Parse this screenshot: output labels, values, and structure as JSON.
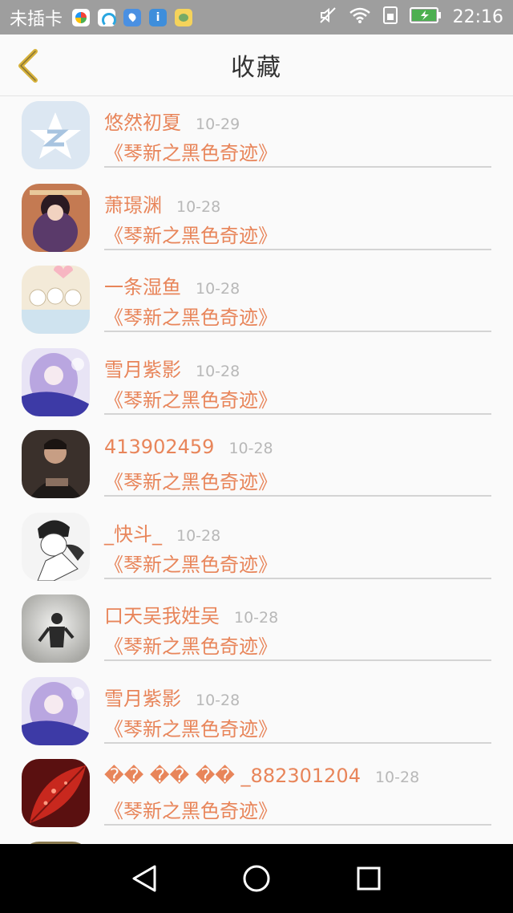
{
  "status_bar": {
    "carrier": "未插卡",
    "time": "22:16"
  },
  "header": {
    "title": "收藏",
    "back_icon": "chevron-left-icon",
    "accent": "#d6b13a"
  },
  "colors": {
    "name": "#e8855a",
    "date": "#b8b8b8",
    "divider": "#d4d4d4"
  },
  "items": [
    {
      "user": "悠然初夏",
      "date": "10-29",
      "book": "《琴新之黑色奇迹》",
      "avatar": "qq-default-avatar"
    },
    {
      "user": "萧璟渊",
      "date": "10-28",
      "book": "《琴新之黑色奇迹》",
      "avatar": "anime-avatar"
    },
    {
      "user": "一条湿鱼",
      "date": "10-28",
      "book": "《琴新之黑色奇迹》",
      "avatar": "cartoon-avatar"
    },
    {
      "user": "雪月紫影",
      "date": "10-28",
      "book": "《琴新之黑色奇迹》",
      "avatar": "purple-anime-avatar"
    },
    {
      "user": "413902459",
      "date": "10-28",
      "book": "《琴新之黑色奇迹》",
      "avatar": "photo-avatar"
    },
    {
      "user": "_快斗_",
      "date": "10-28",
      "book": "《琴新之黑色奇迹》",
      "avatar": "manga-avatar"
    },
    {
      "user": "口天吴我姓吴",
      "date": "10-28",
      "book": "《琴新之黑色奇迹》",
      "avatar": "silhouette-avatar"
    },
    {
      "user": "雪月紫影",
      "date": "10-28",
      "book": "《琴新之黑色奇迹》",
      "avatar": "purple-anime-avatar"
    },
    {
      "user": "�� �� �� _882301204",
      "date": "10-28",
      "book": "《琴新之黑色奇迹》",
      "avatar": "red-leaf-avatar"
    }
  ],
  "nav": {
    "back_icon": "triangle-back-icon",
    "home_icon": "circle-home-icon",
    "recents_icon": "square-recents-icon"
  }
}
